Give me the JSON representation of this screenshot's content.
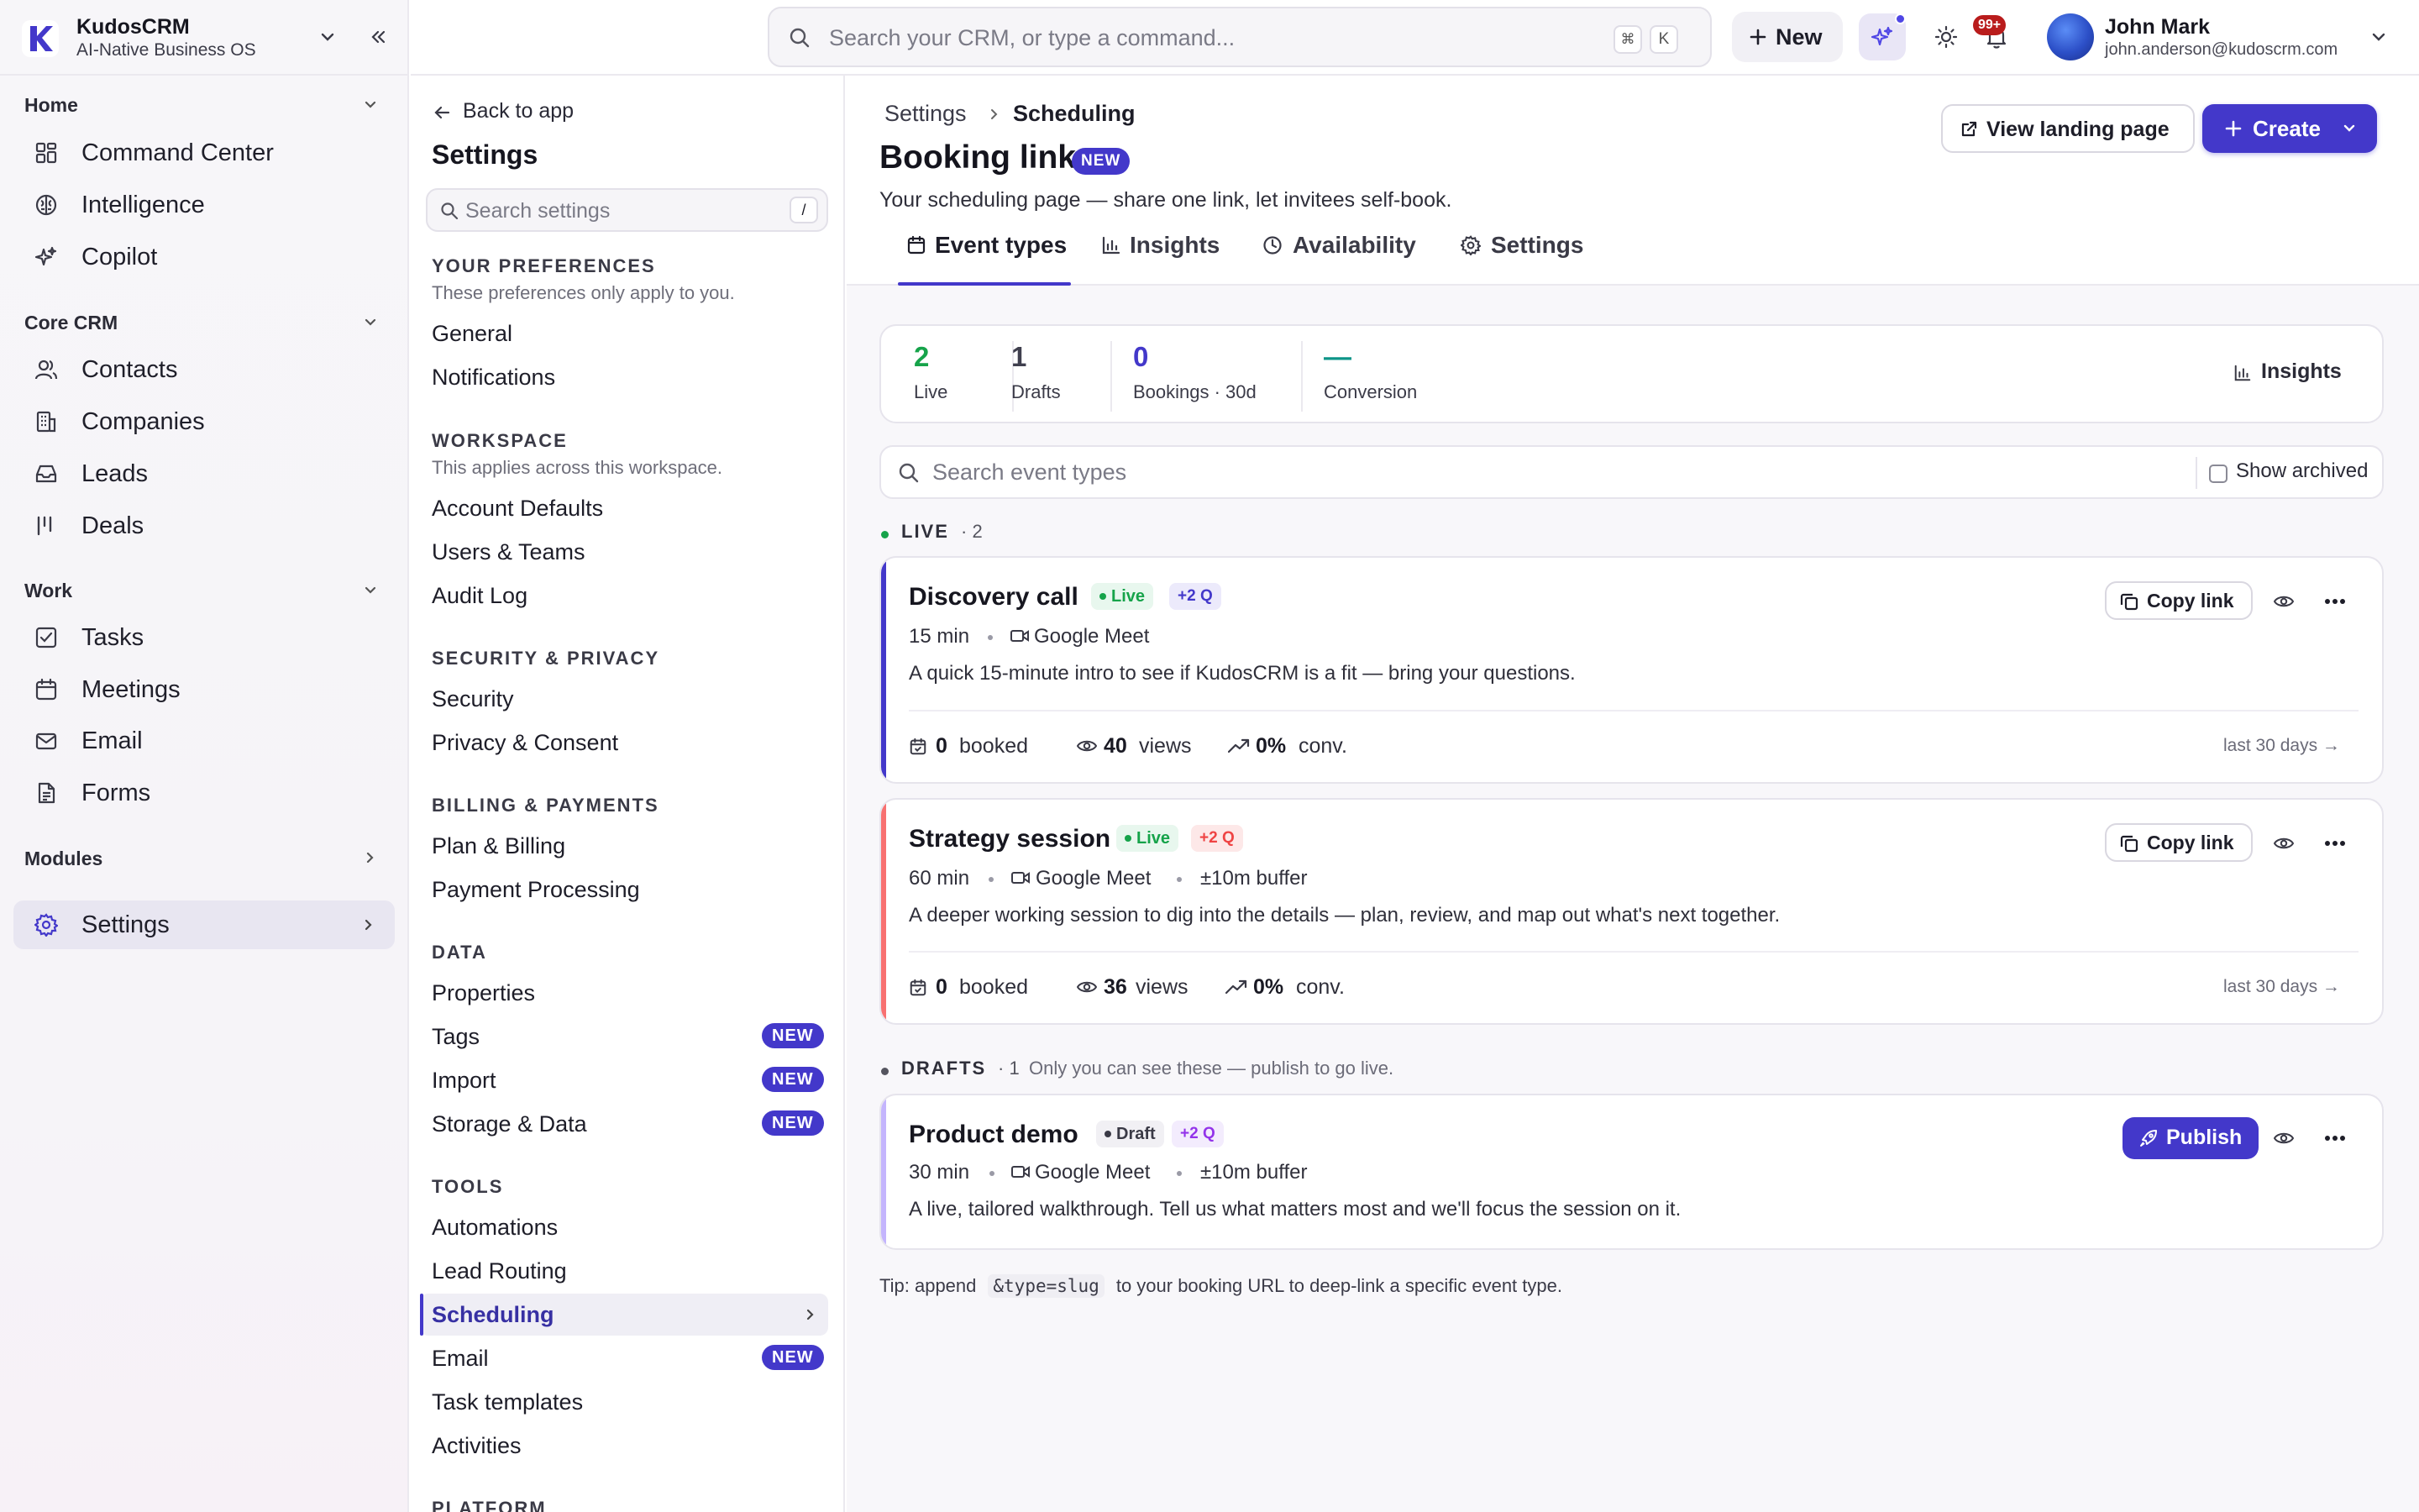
{
  "brand": {
    "name": "KudosCRM",
    "tagline": "AI-Native Business OS"
  },
  "sidebar": {
    "sections": [
      {
        "title": "Home",
        "items": [
          "Command Center",
          "Intelligence",
          "Copilot"
        ]
      },
      {
        "title": "Core CRM",
        "items": [
          "Contacts",
          "Companies",
          "Leads",
          "Deals"
        ]
      },
      {
        "title": "Work",
        "items": [
          "Tasks",
          "Meetings",
          "Email",
          "Forms"
        ]
      }
    ],
    "modules_label": "Modules",
    "settings_label": "Settings"
  },
  "topbar": {
    "search_placeholder": "Search your CRM, or type a command...",
    "kbd_1": "⌘",
    "kbd_2": "K",
    "new_label": "New",
    "notif_count": "99+",
    "user_name": "John Mark",
    "user_email": "john.anderson@kudoscrm.com"
  },
  "settings_nav": {
    "back_label": "Back to app",
    "title": "Settings",
    "search_placeholder": "Search settings",
    "search_kbd": "/",
    "new_badge": "NEW",
    "groups": [
      {
        "title": "YOUR PREFERENCES",
        "hint": "These preferences only apply to you.",
        "items": [
          "General",
          "Notifications"
        ]
      },
      {
        "title": "WORKSPACE",
        "hint": "This applies across this workspace.",
        "items": [
          "Account Defaults",
          "Users & Teams",
          "Audit Log"
        ]
      },
      {
        "title": "SECURITY & PRIVACY",
        "items": [
          "Security",
          "Privacy & Consent"
        ]
      },
      {
        "title": "BILLING & PAYMENTS",
        "items": [
          "Plan & Billing",
          "Payment Processing"
        ]
      },
      {
        "title": "DATA",
        "items": [
          "Properties",
          "Tags",
          "Import",
          "Storage & Data"
        ]
      },
      {
        "title": "TOOLS",
        "items": [
          "Automations",
          "Lead Routing",
          "Scheduling",
          "Email",
          "Task templates",
          "Activities"
        ]
      },
      {
        "title": "PLATFORM"
      }
    ]
  },
  "page": {
    "breadcrumb_root": "Settings",
    "breadcrumb_current": "Scheduling",
    "title": "Booking link",
    "title_badge": "NEW",
    "subtitle": "Your scheduling page — share one link, let invitees self-book.",
    "view_landing_label": "View landing page",
    "create_label": "Create",
    "tabs": [
      "Event types",
      "Insights",
      "Availability",
      "Settings"
    ],
    "active_tab": "Event types"
  },
  "stats": [
    {
      "value": "2",
      "label": "Live",
      "color": "#16a34a"
    },
    {
      "value": "1",
      "label": "Drafts",
      "color": "#3f3f4e"
    },
    {
      "value": "0",
      "label": "Bookings · 30d",
      "color": "#4338ca"
    },
    {
      "value": "—",
      "label": "Conversion",
      "color": "#0d9488"
    }
  ],
  "stats_insights_label": "Insights",
  "event_search_placeholder": "Search event types",
  "show_archived_label": "Show archived",
  "live_group": {
    "label": "LIVE",
    "count": "· 2"
  },
  "drafts_group": {
    "label": "DRAFTS",
    "count": "· 1",
    "note": "Only you can see these — publish to go live."
  },
  "events": [
    {
      "title": "Discovery call",
      "status": "Live",
      "questions": "+2 Q",
      "duration": "15 min",
      "location": "Google Meet",
      "description": "A quick 15-minute intro to see if KudosCRM is a fit — bring your questions.",
      "booked": "0",
      "booked_label": "booked",
      "views": "40",
      "views_label": "views",
      "conv": "0%",
      "conv_label": "conv.",
      "period": "last 30 days →",
      "action": "Copy link",
      "accent": "#4338ca"
    },
    {
      "title": "Strategy session",
      "status": "Live",
      "questions": "+2 Q",
      "duration": "60 min",
      "location": "Google Meet",
      "buffer": "±10m buffer",
      "description": "A deeper working session to dig into the details — plan, review, and map out what's next together.",
      "booked": "0",
      "booked_label": "booked",
      "views": "36",
      "views_label": "views",
      "conv": "0%",
      "conv_label": "conv.",
      "period": "last 30 days →",
      "action": "Copy link",
      "accent": "#f87171"
    },
    {
      "title": "Product demo",
      "status": "Draft",
      "questions": "+2 Q",
      "duration": "30 min",
      "location": "Google Meet",
      "buffer": "±10m buffer",
      "description": "A live, tailored walkthrough. Tell us what matters most and we'll focus the session on it.",
      "action": "Publish",
      "accent": "#c4b5fd"
    }
  ],
  "tip": {
    "prefix": "Tip: append",
    "code": "&type=slug",
    "suffix": "to your booking URL to deep-link a specific event type."
  }
}
